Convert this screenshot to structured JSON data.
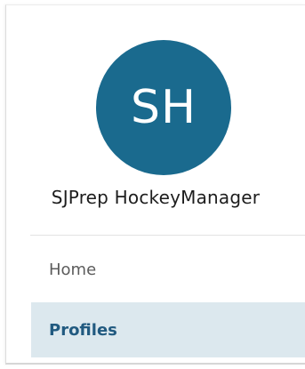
{
  "colors": {
    "avatar_bg": "#1a6a8e",
    "active_nav_bg": "#dce8ee",
    "active_nav_text": "#215a80"
  },
  "profile": {
    "initials": "SH",
    "name": "SJPrep HockeyManager"
  },
  "nav": {
    "items": [
      {
        "label": "Home",
        "active": false
      },
      {
        "label": "Profiles",
        "active": true
      }
    ]
  }
}
